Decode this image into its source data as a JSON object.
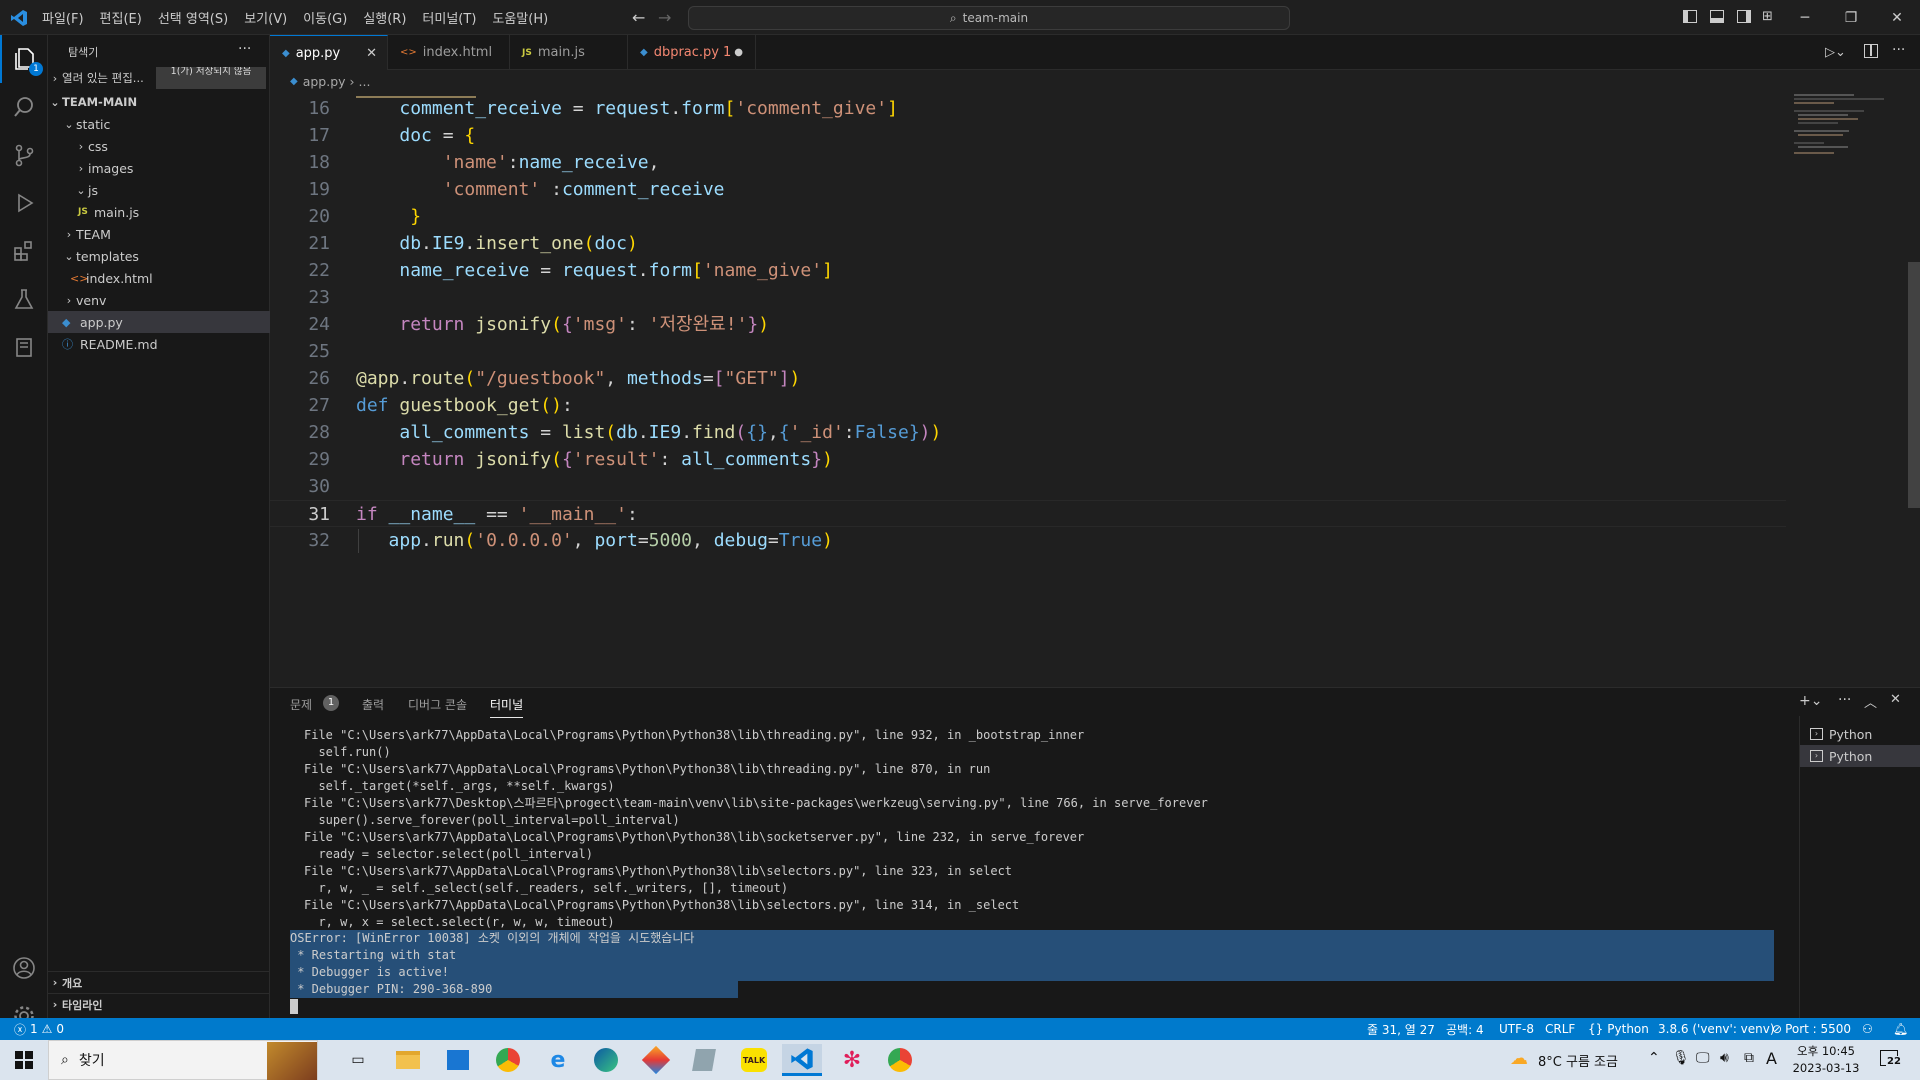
{
  "titlebar": {
    "menu": [
      "파일(F)",
      "편집(E)",
      "선택 영역(S)",
      "보기(V)",
      "이동(G)",
      "실행(R)",
      "터미널(T)",
      "도움말(H)"
    ],
    "search_text": "team-main"
  },
  "activity": {
    "badge": "1"
  },
  "sidebar": {
    "header": "탐색기",
    "open_editors": "열려 있는 편집...",
    "unsaved_note": "1(가) 저장되지 않음",
    "root": "TEAM-MAIN",
    "items": [
      "static",
      "css",
      "images",
      "js",
      "main.js",
      "TEAM",
      "templates",
      "index.html",
      "venv",
      "app.py",
      "README.md"
    ],
    "outline": "개요",
    "timeline": "타임라인"
  },
  "tabs": [
    {
      "label": "app.py"
    },
    {
      "label": "index.html"
    },
    {
      "label": "main.js"
    },
    {
      "label": "dbprac.py",
      "badge": "1"
    }
  ],
  "breadcrumb": [
    "app.py",
    "..."
  ],
  "editor": {
    "line_numbers": [
      "16",
      "17",
      "18",
      "19",
      "20",
      "21",
      "22",
      "23",
      "24",
      "25",
      "26",
      "27",
      "28",
      "29",
      "30",
      "31",
      "32"
    ]
  },
  "panel": {
    "tabs": [
      "문제",
      "출력",
      "디버그 콘솔",
      "터미널"
    ],
    "problem_count": "1",
    "terminal_lines": [
      "File \"C:\\Users\\ark77\\AppData\\Local\\Programs\\Python\\Python38\\lib\\threading.py\", line 932, in _bootstrap_inner",
      "  self.run()",
      "File \"C:\\Users\\ark77\\AppData\\Local\\Programs\\Python\\Python38\\lib\\threading.py\", line 870, in run",
      "  self._target(*self._args, **self._kwargs)",
      "File \"C:\\Users\\ark77\\Desktop\\스파르타\\progect\\team-main\\venv\\lib\\site-packages\\werkzeug\\serving.py\", line 766, in serve_forever",
      "  super().serve_forever(poll_interval=poll_interval)",
      "File \"C:\\Users\\ark77\\AppData\\Local\\Programs\\Python\\Python38\\lib\\socketserver.py\", line 232, in serve_forever",
      "  ready = selector.select(poll_interval)",
      "File \"C:\\Users\\ark77\\AppData\\Local\\Programs\\Python\\Python38\\lib\\selectors.py\", line 323, in select",
      "  r, w, _ = self._select(self._readers, self._writers, [], timeout)",
      "File \"C:\\Users\\ark77\\AppData\\Local\\Programs\\Python\\Python38\\lib\\selectors.py\", line 314, in _select",
      "  r, w, x = select.select(r, w, w, timeout)"
    ],
    "highlighted_lines": [
      "OSError: [WinError 10038] 소켓 이외의 개체에 작업을 시도했습니다",
      " * Restarting with stat",
      " * Debugger is active!",
      " * Debugger PIN: 290-368-890"
    ],
    "terminal_list": [
      "Python",
      "Python"
    ]
  },
  "status": {
    "errors": "1",
    "warnings": "0",
    "position": "줄 31, 열 27",
    "spaces": "공백: 4",
    "encoding": "UTF-8",
    "eol": "CRLF",
    "language": "Python",
    "interpreter": "3.8.6 ('venv': venv)",
    "port": "Port : 5500"
  },
  "taskbar": {
    "search": "찾기",
    "weather": "8°C  구름 조금",
    "ime": "A",
    "time": "오후 10:45",
    "date": "2023-03-13",
    "notification_count": "22"
  }
}
